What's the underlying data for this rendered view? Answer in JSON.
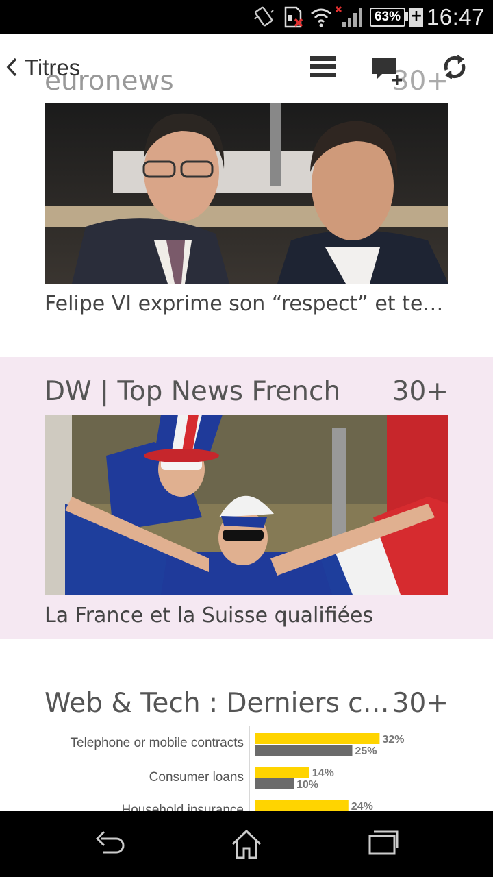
{
  "status_bar": {
    "time": "16:47",
    "battery_percent": "63%",
    "battery_charging_symbol": "+",
    "icons": [
      "vibrate-icon",
      "sim-error-icon",
      "wifi-icon",
      "signal-icon"
    ]
  },
  "action_bar": {
    "back_label": "Titres",
    "icons": [
      "list-icon",
      "add-comment-icon",
      "refresh-icon"
    ]
  },
  "feeds": [
    {
      "name": "euronews",
      "count": "30+",
      "caption": "Felipe VI exprime son “respect” et tend la...",
      "image_alt": "Two men in suits smiling at a sports event"
    },
    {
      "name": "DW | Top News French",
      "count": "30+",
      "caption": "La France et la Suisse qualifiées",
      "image_alt": "French football fans with flag and hats"
    },
    {
      "name": "Web & Tech : Derniers cont...",
      "count": "30+",
      "chart": {
        "rows": [
          {
            "label": "Telephone or mobile contracts",
            "v1": "32%",
            "v2": "25%"
          },
          {
            "label": "Consumer loans",
            "v1": "14%",
            "v2": "10%"
          },
          {
            "label": "Household insurance",
            "v1": "24%"
          }
        ]
      }
    }
  ],
  "chart_values": {
    "rows": [
      {
        "v1": 32,
        "v2": 25
      },
      {
        "v1": 14,
        "v2": 10
      },
      {
        "v1": 24,
        "v2": null
      }
    ],
    "colors": {
      "v1": "#ffd400",
      "v2": "#6b6b6b"
    }
  },
  "nav_bar": {
    "icons": [
      "back-nav-icon",
      "home-icon",
      "recents-icon"
    ]
  }
}
